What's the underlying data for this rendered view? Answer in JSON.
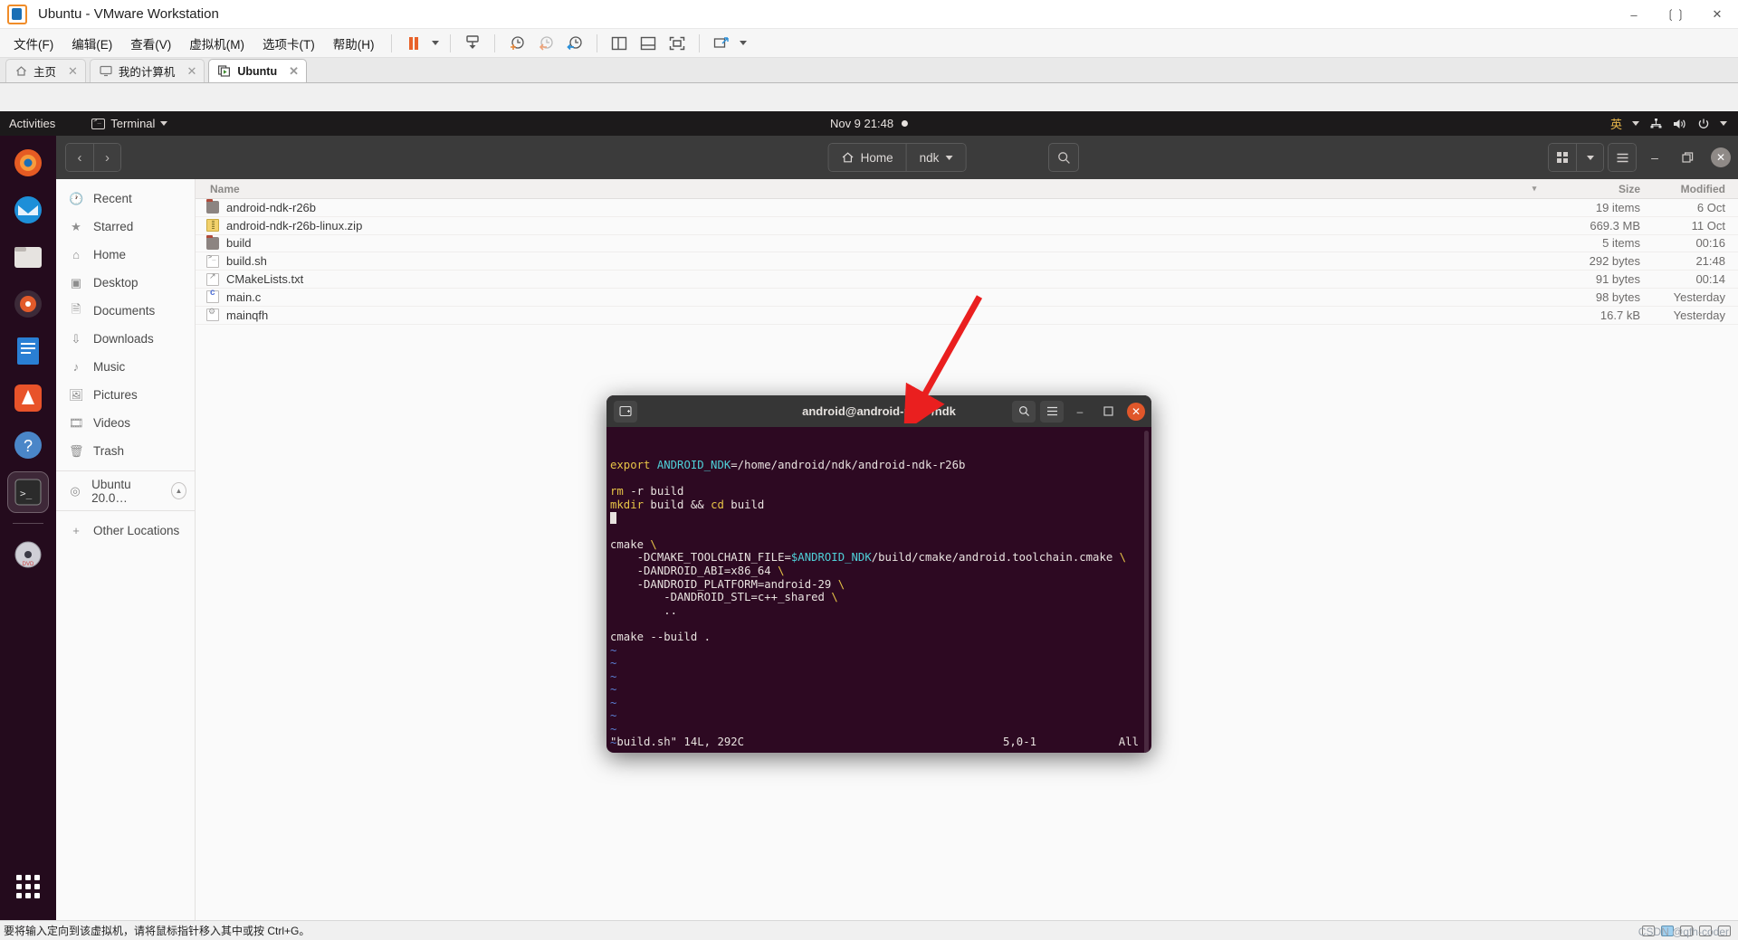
{
  "vmware": {
    "title": "Ubuntu - VMware Workstation",
    "window_buttons": [
      "minimize",
      "restore",
      "close"
    ],
    "menus": [
      {
        "label": "文件(F)",
        "mnemonic": "F"
      },
      {
        "label": "编辑(E)",
        "mnemonic": "E"
      },
      {
        "label": "查看(V)",
        "mnemonic": "V"
      },
      {
        "label": "虚拟机(M)",
        "mnemonic": "M"
      },
      {
        "label": "选项卡(T)",
        "mnemonic": "T"
      },
      {
        "label": "帮助(H)",
        "mnemonic": "H"
      }
    ],
    "toolbar_icons": [
      "pause-icon",
      "dropdown-caret-icon",
      "send-key-icon",
      "snapshot-take-icon",
      "snapshot-revert-icon",
      "snapshot-manager-icon",
      "view-sidebar-icon",
      "view-console-icon",
      "view-fullscreen-icon",
      "unity-icon",
      "unity-caret-icon"
    ],
    "tabs": [
      {
        "label": "主页",
        "icon": "home-icon",
        "active": false
      },
      {
        "label": "我的计算机",
        "icon": "monitor-icon",
        "active": false
      },
      {
        "label": "Ubuntu",
        "icon": "vm-running-icon",
        "active": true
      }
    ],
    "statusbar": {
      "message": "要将输入定向到该虚拟机，请将鼠标指针移入其中或按 Ctrl+G。",
      "watermark": "CSDN @qfh-coder"
    }
  },
  "gnome": {
    "activities": "Activities",
    "app_name": "Terminal",
    "clock": "Nov 9  21:48",
    "keyboard_layout": "英",
    "indicators": [
      "network-icon",
      "volume-icon",
      "power-icon",
      "menu-caret-icon"
    ],
    "dock": [
      {
        "name": "firefox",
        "label": "Firefox"
      },
      {
        "name": "thunderbird",
        "label": "Thunderbird"
      },
      {
        "name": "files",
        "label": "Files"
      },
      {
        "name": "rhythmbox",
        "label": "Rhythmbox"
      },
      {
        "name": "libreoffice-writer",
        "label": "LibreOffice Writer"
      },
      {
        "name": "ubuntu-software",
        "label": "Ubuntu Software"
      },
      {
        "name": "help",
        "label": "Help"
      },
      {
        "name": "terminal",
        "label": "Terminal"
      },
      {
        "name": "dvd",
        "label": "Ubuntu 20.0 DVD"
      }
    ],
    "show_apps": "Show Applications"
  },
  "nautilus": {
    "nav": {
      "back": "‹",
      "forward": "›"
    },
    "breadcrumbs": [
      {
        "label": "Home",
        "icon": "home-icon"
      },
      {
        "label": "ndk",
        "icon": "",
        "has_caret": true
      }
    ],
    "search_placeholder": "Search",
    "buttons": {
      "grid_view": "grid-view-icon",
      "view_caret": "chevron-down-icon",
      "hamburger": "menu-icon",
      "minimize": "–",
      "maximize": "❐",
      "close": "✕"
    },
    "sidebar": [
      {
        "label": "Recent",
        "icon": "clock-icon"
      },
      {
        "label": "Starred",
        "icon": "star-icon"
      },
      {
        "label": "Home",
        "icon": "home-icon"
      },
      {
        "label": "Desktop",
        "icon": "desktop-icon"
      },
      {
        "label": "Documents",
        "icon": "document-icon"
      },
      {
        "label": "Downloads",
        "icon": "download-icon"
      },
      {
        "label": "Music",
        "icon": "music-icon"
      },
      {
        "label": "Pictures",
        "icon": "picture-icon"
      },
      {
        "label": "Videos",
        "icon": "video-icon"
      },
      {
        "label": "Trash",
        "icon": "trash-icon"
      }
    ],
    "sidebar_devices": [
      {
        "label": "Ubuntu 20.0…",
        "icon": "disc-icon",
        "eject": true
      }
    ],
    "sidebar_other": {
      "label": "Other Locations",
      "icon": "plus-icon"
    },
    "columns": {
      "name": "Name",
      "size": "Size",
      "modified": "Modified"
    },
    "files": [
      {
        "name": "android-ndk-r26b",
        "icon": "folder",
        "size": "19 items",
        "modified": "6 Oct"
      },
      {
        "name": "android-ndk-r26b-linux.zip",
        "icon": "zip",
        "size": "669.3 MB",
        "modified": "11 Oct"
      },
      {
        "name": "build",
        "icon": "folder",
        "size": "5 items",
        "modified": "00:16"
      },
      {
        "name": "build.sh",
        "icon": "sh",
        "size": "292 bytes",
        "modified": "21:48"
      },
      {
        "name": "CMakeLists.txt",
        "icon": "txt",
        "size": "91 bytes",
        "modified": "00:14"
      },
      {
        "name": "main.c",
        "icon": "c",
        "size": "98 bytes",
        "modified": "Yesterday"
      },
      {
        "name": "mainqfh",
        "icon": "bin",
        "size": "16.7 kB",
        "modified": "Yesterday"
      }
    ]
  },
  "terminal": {
    "title": "android@android-pc: ~/ndk",
    "new_tab_icon": "new-tab-icon",
    "search_icon": "search-icon",
    "menu_icon": "hamburger-icon",
    "minimize": "–",
    "maximize": "❐",
    "close": "✕",
    "lines": [
      [
        {
          "t": "export ",
          "c": "y"
        },
        {
          "t": "ANDROID_NDK",
          "c": "c"
        },
        {
          "t": "=/home/android/ndk/android-ndk-r26b",
          "c": "w"
        }
      ],
      [],
      [
        {
          "t": "rm",
          "c": "y"
        },
        {
          "t": " -r build",
          "c": "w"
        }
      ],
      [
        {
          "t": "mkdir",
          "c": "y"
        },
        {
          "t": " build && ",
          "c": "w"
        },
        {
          "t": "cd",
          "c": "y"
        },
        {
          "t": " build",
          "c": "w"
        }
      ],
      [
        {
          "t": "CURSOR",
          "c": "cursor"
        }
      ],
      [],
      [
        {
          "t": "cmake ",
          "c": "w"
        },
        {
          "t": "\\",
          "c": "y"
        }
      ],
      [
        {
          "t": "    -DCMAKE_TOOLCHAIN_FILE=",
          "c": "w"
        },
        {
          "t": "$ANDROID_NDK",
          "c": "c"
        },
        {
          "t": "/build/cmake/android.toolchain.cmake ",
          "c": "w"
        },
        {
          "t": "\\",
          "c": "y"
        }
      ],
      [
        {
          "t": "    -DANDROID_ABI=x86_64 ",
          "c": "w"
        },
        {
          "t": "\\",
          "c": "y"
        }
      ],
      [
        {
          "t": "    -DANDROID_PLATFORM=android-29 ",
          "c": "w"
        },
        {
          "t": "\\",
          "c": "y"
        }
      ],
      [
        {
          "t": "        -DANDROID_STL=c++_shared ",
          "c": "w"
        },
        {
          "t": "\\",
          "c": "y"
        }
      ],
      [
        {
          "t": "        ..",
          "c": "w"
        }
      ],
      [],
      [
        {
          "t": "cmake --build .",
          "c": "w"
        }
      ],
      [
        {
          "t": "~",
          "c": "tilde"
        }
      ],
      [
        {
          "t": "~",
          "c": "tilde"
        }
      ],
      [
        {
          "t": "~",
          "c": "tilde"
        }
      ],
      [
        {
          "t": "~",
          "c": "tilde"
        }
      ],
      [
        {
          "t": "~",
          "c": "tilde"
        }
      ],
      [
        {
          "t": "~",
          "c": "tilde"
        }
      ],
      [
        {
          "t": "~",
          "c": "tilde"
        }
      ],
      [
        {
          "t": "~",
          "c": "tilde"
        }
      ],
      [
        {
          "t": "~",
          "c": "tilde"
        }
      ]
    ],
    "status": {
      "file": "\"build.sh\" 14L, 292C",
      "position": "5,0-1",
      "scroll": "All"
    }
  },
  "annotation": {
    "arrow_color": "#e81123",
    "name": "red-arrow-pointing-to-terminal-title"
  }
}
